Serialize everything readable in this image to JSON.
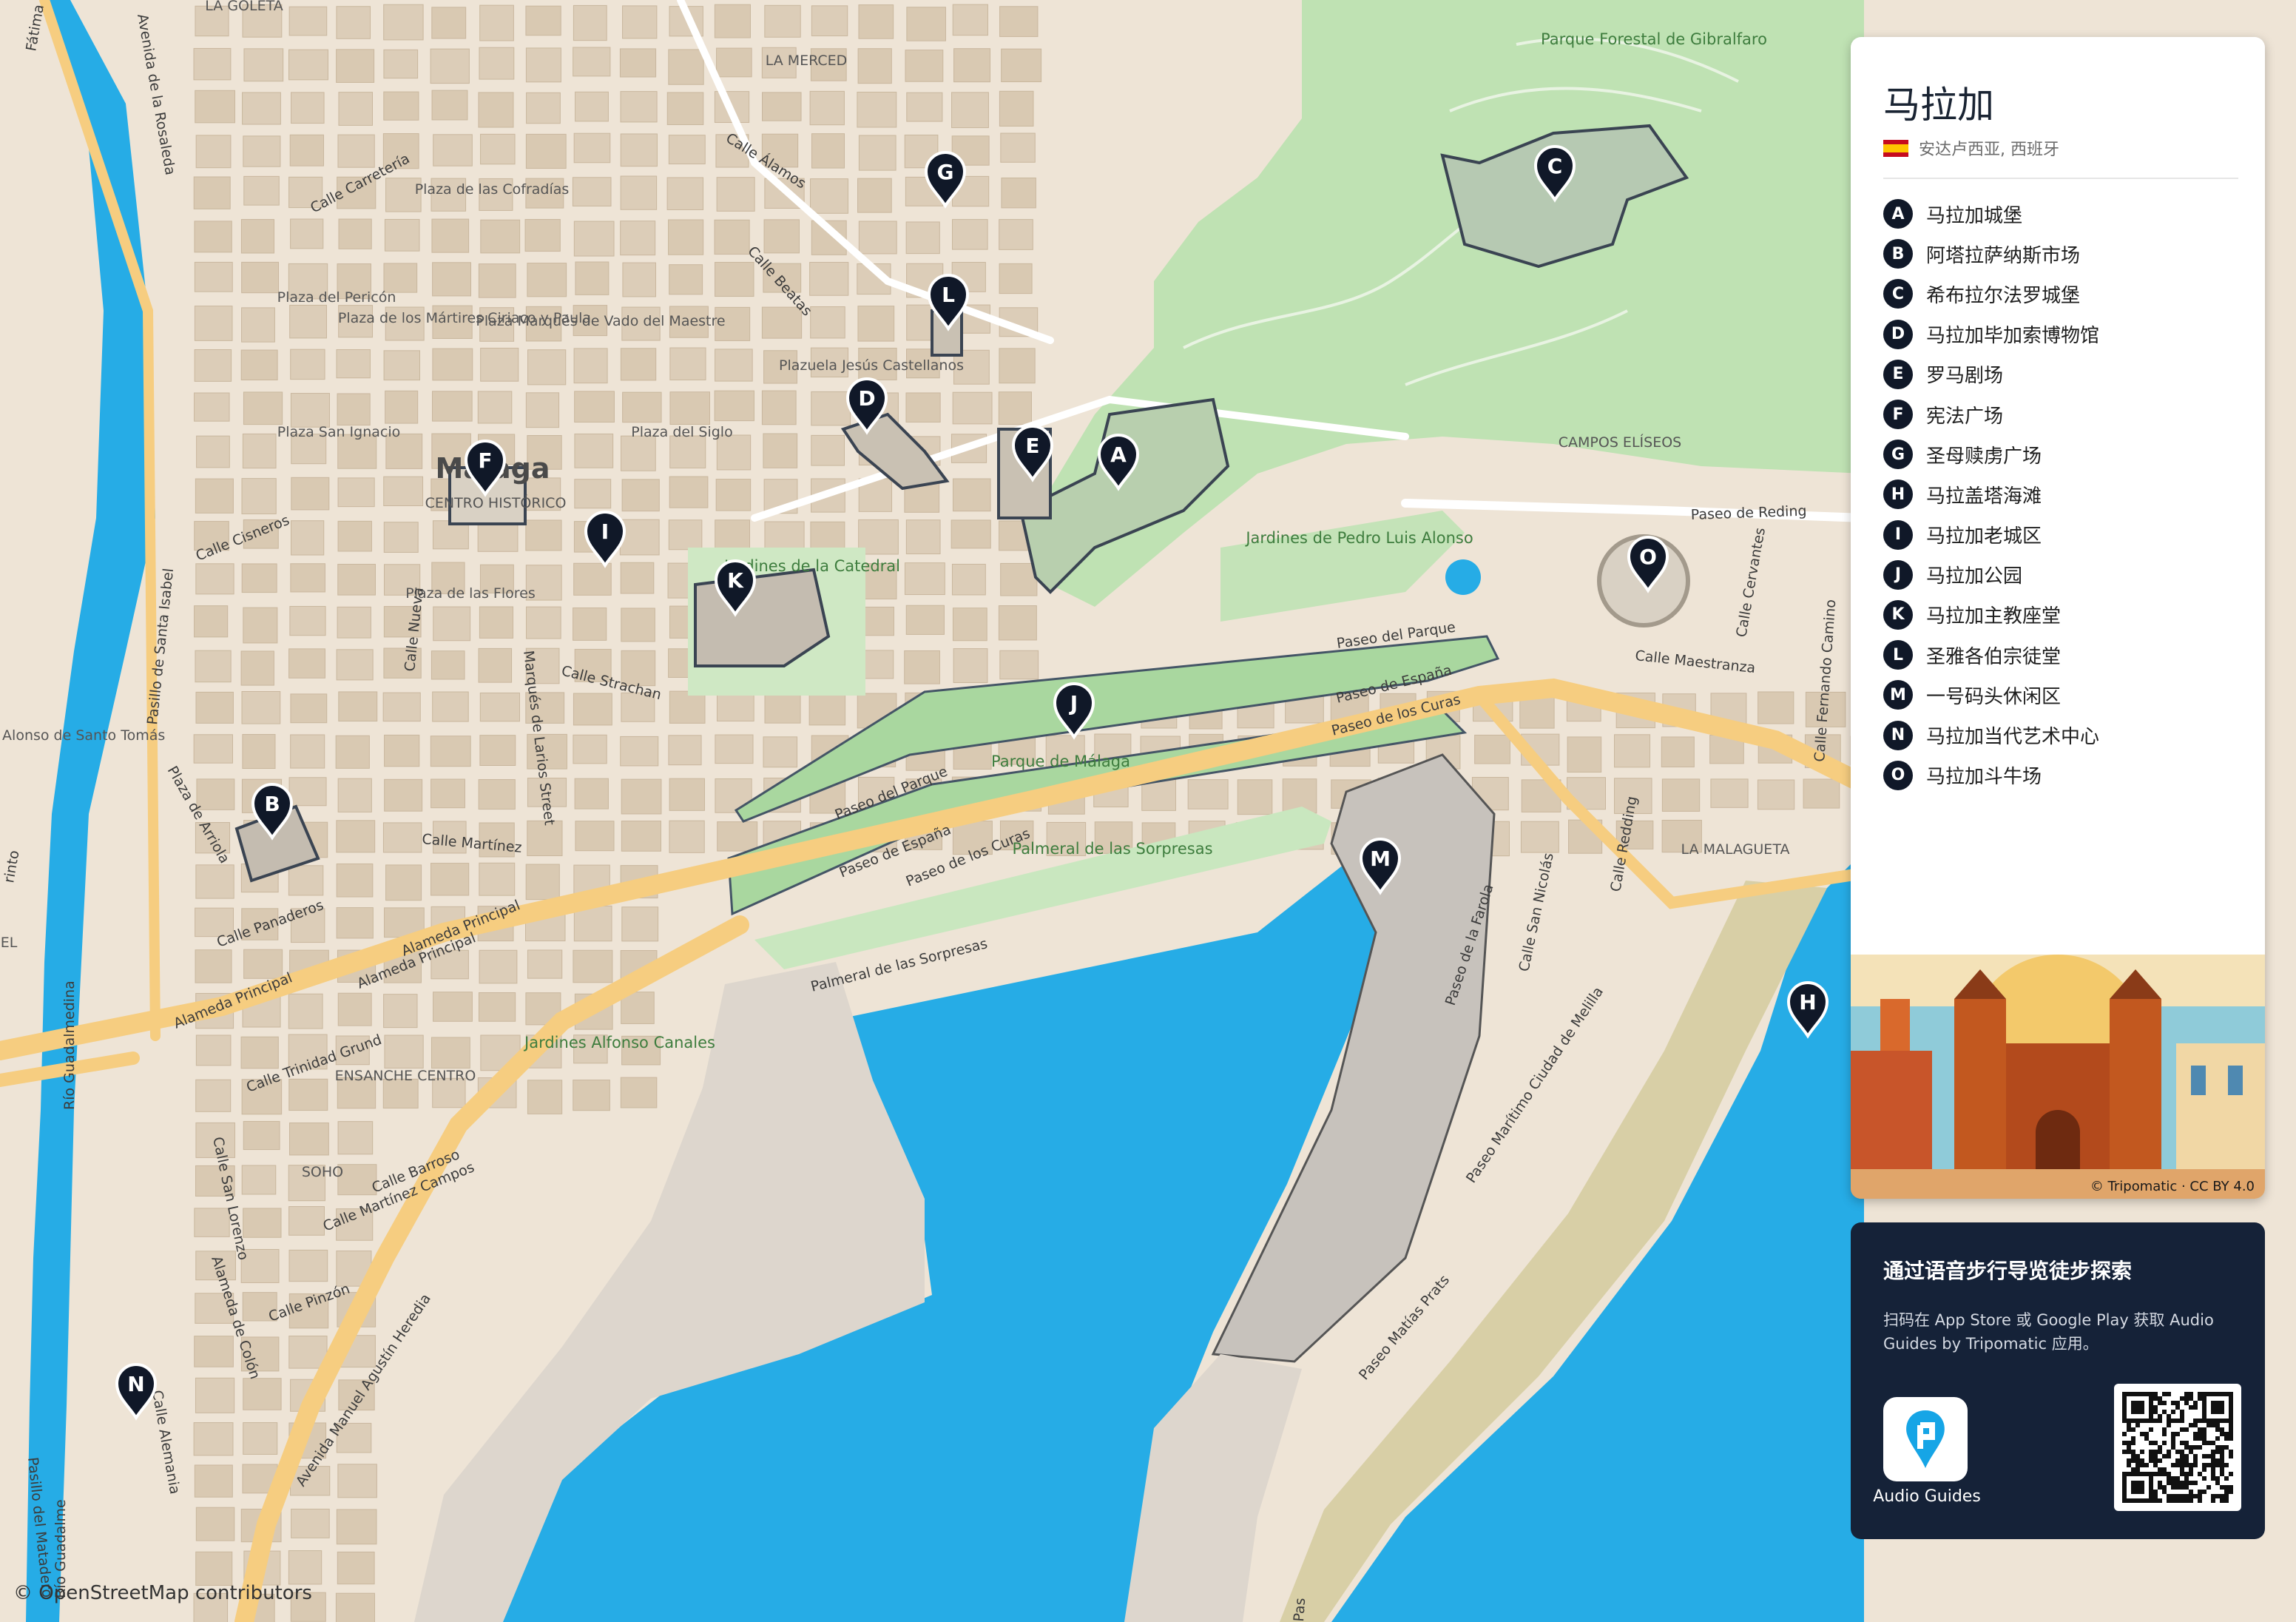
{
  "map": {
    "city_label": "Málaga",
    "osm_credit": "© OpenStreetMap contributors",
    "colors": {
      "land": "#eee4d6",
      "water": "#26ace6",
      "park": "#bfe2b3",
      "pin": "#101828",
      "road_major": "#f6cd80"
    },
    "place_labels": {
      "la_goleta": "LA GOLETA",
      "la_merced": "LA MERCED",
      "plaza_cofradias": "Plaza de las Cofradías",
      "plaza_pericon": "Plaza del Pericón",
      "plaza_martires": "Plaza de los Mártires Ciriaco y Paula",
      "plaza_marques": "Plaza Marqués de Vado del Maestre",
      "plaza_jesus": "Plazuela Jesús Castellanos",
      "plaza_siglo": "Plaza del Siglo",
      "plaza_san_ignacio": "Plaza San Ignacio",
      "centro_historico": "CENTRO HISTÓRICO",
      "plaza_flores": "Plaza de las Flores",
      "plaza_fray": "Plaza Fray Alonso de Santo Tomás",
      "ensanche": "ENSANCHE CENTRO",
      "soho": "SOHO",
      "el": "EL",
      "campos_eliseos": "CAMPOS ELÍSEOS",
      "la_malagueta": "LA MALAGUETA"
    },
    "park_labels": {
      "gibralfaro": "Parque Forestal de Gibralfaro",
      "jardines_catedral": "Jardines de la Catedral",
      "jardines_pedro": "Jardines de Pedro Luis Alonso",
      "parque_malaga": "Parque de Málaga",
      "palmeral": "Palmeral de las Sorpresas",
      "jardines_alfonso": "Jardines Alfonso Canales"
    },
    "street_labels": {
      "fatima": "Fátima",
      "rosaleda": "Avenida de la Rosaleda",
      "carreteria": "Calle Carretería",
      "alamos": "Calle Álamos",
      "beatas": "Calle Beatas",
      "cisneros": "Calle Cisneros",
      "nueva": "Calle Nueva",
      "santa_isabel": "Pasillo de Santa Isabel",
      "marques_larios": "Marqués de Larios Street",
      "strachan": "Calle Strachan",
      "arriola": "Plaza de Arriola",
      "martinez": "Calle Martínez",
      "panaderos": "Calle Panaderos",
      "alameda1": "Alameda Principal",
      "alameda2": "Alameda Principal",
      "alameda3": "Alameda Principal",
      "trinidad": "Calle Trinidad Grund",
      "san_lorenzo": "Calle San Lorenzo",
      "barroso": "Calle Barroso",
      "martinez_campos": "Calle Martínez Campos",
      "alameda_colon": "Alameda de Colón",
      "pinzon": "Calle Pinzón",
      "heredia": "Avenida Manuel Agustín Heredia",
      "alemania": "Calle Alemania",
      "matadero": "Pasillo del Matadero",
      "rio_guadalmedina": "Río Guadalmedina",
      "rio_guadalme": "Río Guadalme",
      "paseo_parque1": "Paseo del Parque",
      "paseo_parque2": "Paseo del Parque",
      "paseo_espana1": "Paseo de España",
      "paseo_espana2": "Paseo de España",
      "paseo_curas1": "Paseo de los Curas",
      "paseo_curas2": "Paseo de los Curas",
      "palmeral_street": "Palmeral de las Sorpresas",
      "reding": "Paseo de Reding",
      "maestranza": "Calle Maestranza",
      "cervantes": "Calle Cervantes",
      "fernando_camino": "Calle Fernando Camino",
      "redding": "Calle Redding",
      "san_nicolas": "Calle San Nicolás",
      "farola": "Paseo de la Farola",
      "ciudad_melilla": "Paseo Marítimo Ciudad de Melilla",
      "matias_prats": "Paseo Matías Prats",
      "pas": "Pas",
      "pasillo_tomo": "rinto"
    },
    "pins": [
      "A",
      "B",
      "C",
      "D",
      "E",
      "F",
      "G",
      "H",
      "I",
      "J",
      "K",
      "L",
      "M",
      "N",
      "O"
    ]
  },
  "panel": {
    "title": "马拉加",
    "subtitle": "安达卢西亚, 西班牙",
    "flag_icon": "spain-flag-icon",
    "items": [
      {
        "letter": "A",
        "name": "马拉加城堡"
      },
      {
        "letter": "B",
        "name": "阿塔拉萨纳斯市场"
      },
      {
        "letter": "C",
        "name": "希布拉尔法罗城堡"
      },
      {
        "letter": "D",
        "name": "马拉加毕加索博物馆"
      },
      {
        "letter": "E",
        "name": "罗马剧场"
      },
      {
        "letter": "F",
        "name": "宪法广场"
      },
      {
        "letter": "G",
        "name": "圣母赎虏广场"
      },
      {
        "letter": "H",
        "name": "马拉盖塔海滩"
      },
      {
        "letter": "I",
        "name": "马拉加老城区"
      },
      {
        "letter": "J",
        "name": "马拉加公园"
      },
      {
        "letter": "K",
        "name": "马拉加主教座堂"
      },
      {
        "letter": "L",
        "name": "圣雅各伯宗徒堂"
      },
      {
        "letter": "M",
        "name": "一号码头休闲区"
      },
      {
        "letter": "N",
        "name": "马拉加当代艺术中心"
      },
      {
        "letter": "O",
        "name": "马拉加斗牛场"
      }
    ],
    "poster_credit": "© Tripomatic · CC BY 4.0"
  },
  "audio": {
    "title": "通过语音步行导览徒步探索",
    "description": "扫码在 App Store 或 Google Play 获取 Audio Guides by Tripomatic 应用。",
    "app_label": "Audio Guides"
  }
}
